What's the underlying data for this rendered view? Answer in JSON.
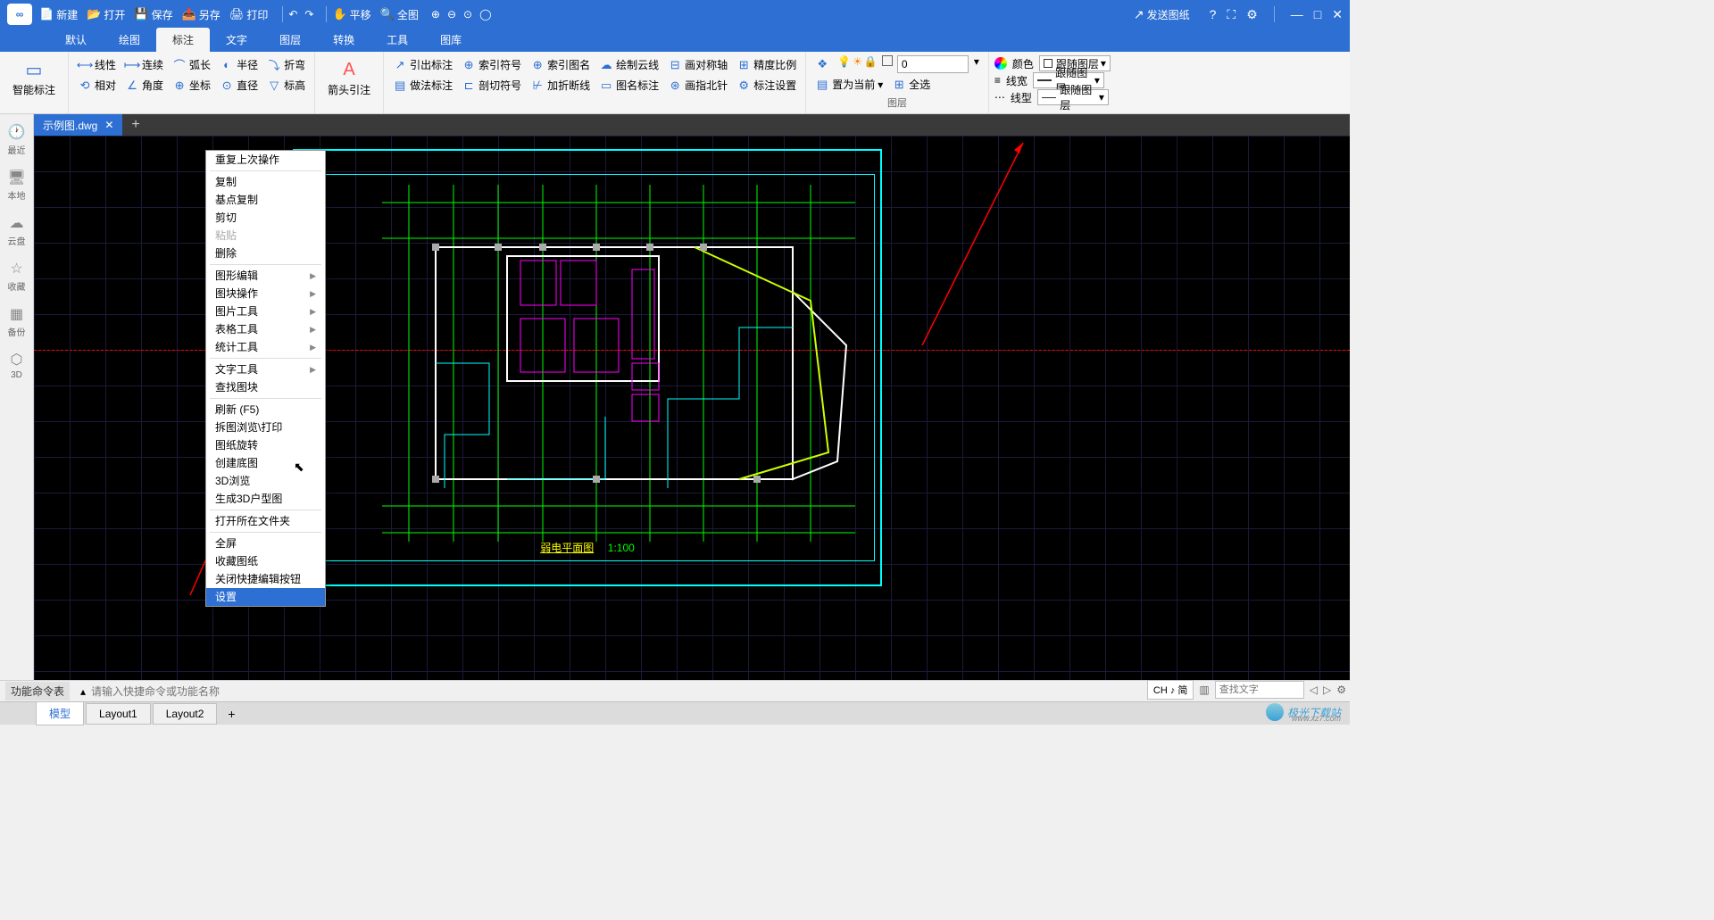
{
  "titlebar": {
    "new": "新建",
    "open": "打开",
    "save": "保存",
    "saveas": "另存",
    "print": "打印",
    "pan": "平移",
    "all": "全图",
    "send": "发送图纸"
  },
  "menus": [
    "默认",
    "绘图",
    "标注",
    "文字",
    "图层",
    "转换",
    "工具",
    "图库"
  ],
  "menus_active_index": 2,
  "ribbon": {
    "g1_label": "智能标注",
    "g1_items": [
      "线性",
      "连续",
      "弧长",
      "半径",
      "折弯",
      "相对",
      "角度",
      "坐标",
      "直径",
      "标高"
    ],
    "g2_label": "箭头引注",
    "g3_items": [
      "引出标注",
      "索引符号",
      "索引图名",
      "绘制云线",
      "画对称轴",
      "精度比例",
      "做法标注",
      "剖切符号",
      "加折断线",
      "图名标注",
      "画指北针",
      "标注设置"
    ],
    "g4_label": "图层",
    "g4_current": "置为当前",
    "g4_selectall": "全选",
    "g4_input": "0",
    "g5_color": "颜色",
    "g5_follow": "跟随图层",
    "g5_linewidth": "线宽",
    "g5_linetype": "线型"
  },
  "sidebar": [
    {
      "icon": "🕐",
      "label": "最近"
    },
    {
      "icon": "🖥",
      "label": "本地"
    },
    {
      "icon": "☁",
      "label": "云盘"
    },
    {
      "icon": "☆",
      "label": "收藏"
    },
    {
      "icon": "▦",
      "label": "备份"
    },
    {
      "icon": "⬡",
      "label": "3D"
    }
  ],
  "doc_tab": "示例图.dwg",
  "context_menu": [
    {
      "label": "重复上次操作"
    },
    {
      "divider": true
    },
    {
      "label": "复制"
    },
    {
      "label": "基点复制"
    },
    {
      "label": "剪切"
    },
    {
      "label": "粘贴",
      "disabled": true
    },
    {
      "label": "删除"
    },
    {
      "divider": true
    },
    {
      "label": "图形编辑",
      "submenu": true
    },
    {
      "label": "图块操作",
      "submenu": true
    },
    {
      "label": "图片工具",
      "submenu": true
    },
    {
      "label": "表格工具",
      "submenu": true
    },
    {
      "label": "统计工具",
      "submenu": true
    },
    {
      "divider": true
    },
    {
      "label": "文字工具",
      "submenu": true
    },
    {
      "label": "查找图块"
    },
    {
      "divider": true
    },
    {
      "label": "刷新 (F5)"
    },
    {
      "label": "拆图浏览\\打印"
    },
    {
      "label": "图纸旋转"
    },
    {
      "label": "创建底图"
    },
    {
      "label": "3D浏览"
    },
    {
      "label": "生成3D户型图"
    },
    {
      "divider": true
    },
    {
      "label": "打开所在文件夹"
    },
    {
      "divider": true
    },
    {
      "label": "全屏"
    },
    {
      "label": "收藏图纸"
    },
    {
      "label": "关闭快捷编辑按钮"
    },
    {
      "label": "设置",
      "highlight": true
    }
  ],
  "drawing_title": "弱电平面图",
  "drawing_scale": "1:100",
  "cmdbar_label": "功能命令表",
  "cmdbar_placeholder": "请输入快捷命令或功能名称",
  "layout_tabs": [
    "模型",
    "Layout1",
    "Layout2"
  ],
  "status_ime": "CH ♪ 简",
  "search_placeholder": "查找文字",
  "watermark": "极光下载站",
  "watermark_url": "www.xz7.com"
}
